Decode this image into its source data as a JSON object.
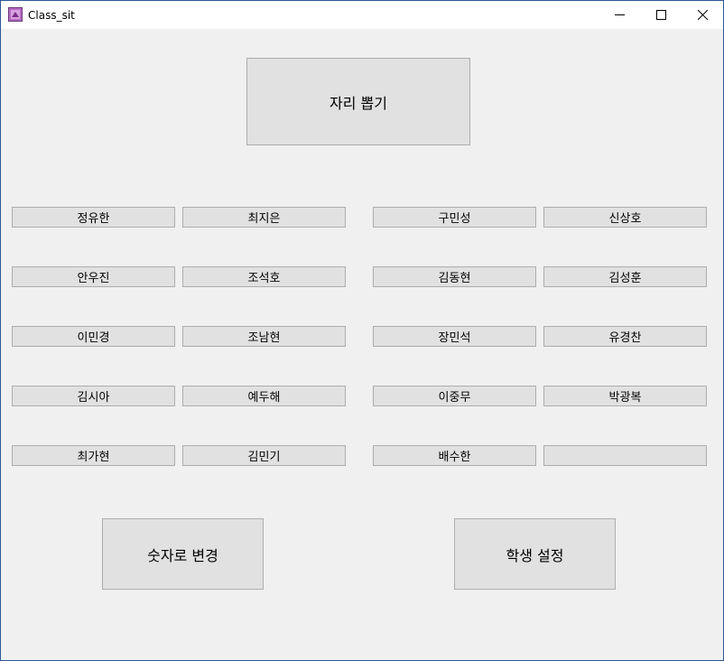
{
  "window": {
    "title": "Class_sit"
  },
  "icons": {
    "app": "app-icon",
    "minimize": "minimize-icon",
    "maximize": "maximize-icon",
    "close": "close-icon"
  },
  "actions": {
    "draw_seats": "자리 뽑기",
    "change_to_number": "숫자로 변경",
    "student_settings": "학생 설정"
  },
  "seats": {
    "left": [
      [
        "정유한",
        "최지은"
      ],
      [
        "안우진",
        "조석호"
      ],
      [
        "이민경",
        "조남현"
      ],
      [
        "김시아",
        "예두해"
      ],
      [
        "최가현",
        "김민기"
      ]
    ],
    "right": [
      [
        "구민성",
        "신상호"
      ],
      [
        "김동현",
        "김성훈"
      ],
      [
        "장민석",
        "유경찬"
      ],
      [
        "이중무",
        "박광복"
      ],
      [
        "배수한",
        ""
      ]
    ]
  }
}
